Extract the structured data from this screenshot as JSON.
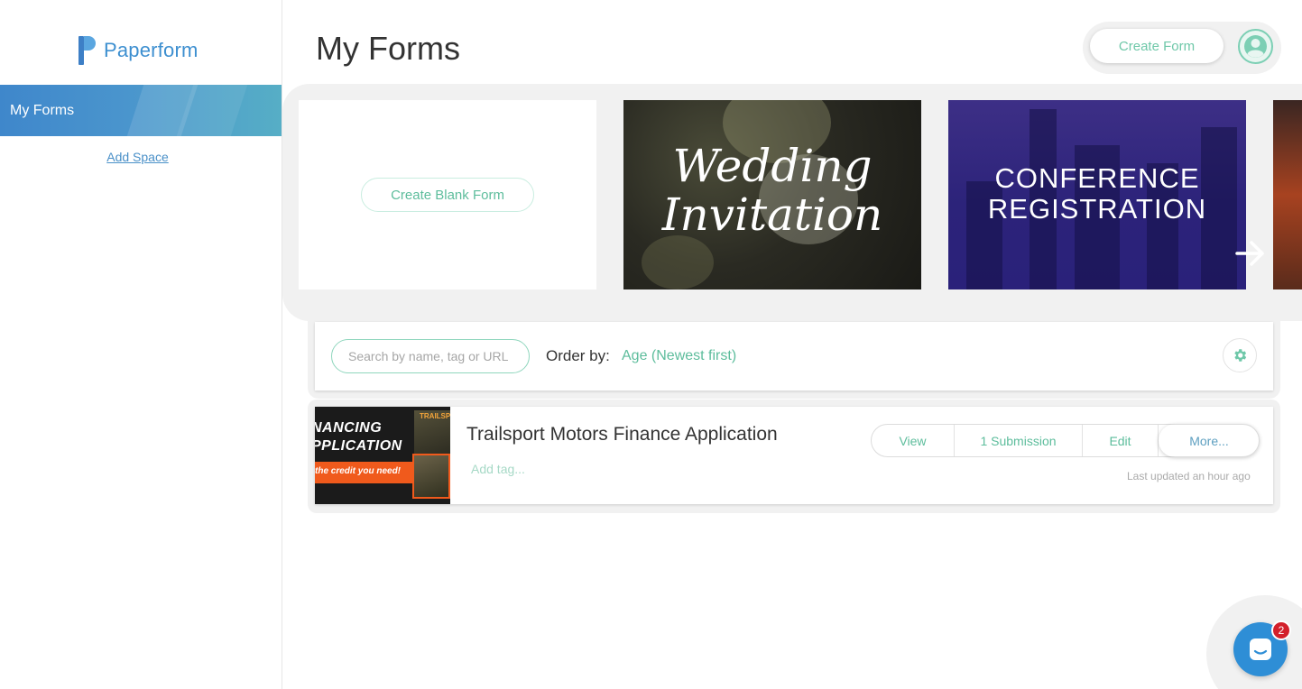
{
  "sidebar": {
    "logo_text": "Paperform",
    "nav": [
      {
        "label": "My Forms",
        "active": true
      }
    ],
    "add_space": "Add Space"
  },
  "header": {
    "title": "My Forms",
    "create_button": "Create Form",
    "avatar_icon": "user-avatar-icon"
  },
  "templates": {
    "blank_button": "Create Blank Form",
    "items": [
      {
        "title_line1": "Wedding",
        "title_line2": "Invitation"
      },
      {
        "title_line1": "CONFERENCE",
        "title_line2": "REGISTRATION"
      }
    ],
    "next_icon": "arrow-right-icon"
  },
  "filters": {
    "search_placeholder": "Search by name, tag or URL",
    "order_label": "Order by:",
    "order_value": "Age (Newest first)",
    "settings_icon": "gear-icon"
  },
  "forms": [
    {
      "name": "Trailsport Motors Finance Application",
      "add_tag": "Add tag...",
      "thumb_line1": "NANCING",
      "thumb_line2": "PPLICATION",
      "thumb_line3": "the credit you need!",
      "thumb_brand": "TRAILSP",
      "actions": {
        "view": "View",
        "submissions": "1 Submission",
        "edit": "Edit",
        "more": "More..."
      },
      "updated": "Last updated an hour ago"
    }
  ],
  "chat": {
    "badge": "2",
    "icon": "chat-icon"
  },
  "colors": {
    "accent": "#5dbd9c",
    "brand_blue": "#3d8fd0",
    "nav_gradient_start": "#3f87cb",
    "nav_gradient_end": "#56aec6",
    "badge": "#d3202b"
  }
}
